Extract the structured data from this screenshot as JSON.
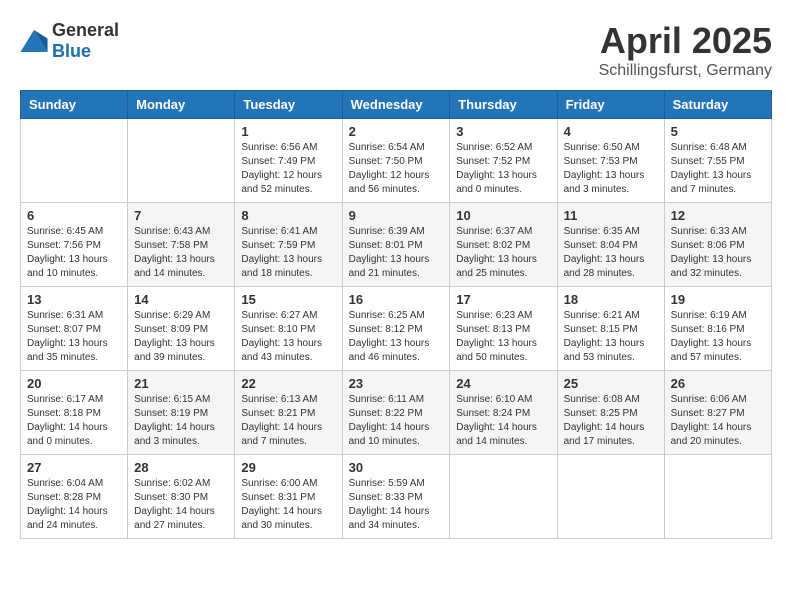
{
  "header": {
    "logo_general": "General",
    "logo_blue": "Blue",
    "title": "April 2025",
    "location": "Schillingsfurst, Germany"
  },
  "weekdays": [
    "Sunday",
    "Monday",
    "Tuesday",
    "Wednesday",
    "Thursday",
    "Friday",
    "Saturday"
  ],
  "weeks": [
    [
      {
        "day": "",
        "info": ""
      },
      {
        "day": "",
        "info": ""
      },
      {
        "day": "1",
        "info": "Sunrise: 6:56 AM\nSunset: 7:49 PM\nDaylight: 12 hours and 52 minutes."
      },
      {
        "day": "2",
        "info": "Sunrise: 6:54 AM\nSunset: 7:50 PM\nDaylight: 12 hours and 56 minutes."
      },
      {
        "day": "3",
        "info": "Sunrise: 6:52 AM\nSunset: 7:52 PM\nDaylight: 13 hours and 0 minutes."
      },
      {
        "day": "4",
        "info": "Sunrise: 6:50 AM\nSunset: 7:53 PM\nDaylight: 13 hours and 3 minutes."
      },
      {
        "day": "5",
        "info": "Sunrise: 6:48 AM\nSunset: 7:55 PM\nDaylight: 13 hours and 7 minutes."
      }
    ],
    [
      {
        "day": "6",
        "info": "Sunrise: 6:45 AM\nSunset: 7:56 PM\nDaylight: 13 hours and 10 minutes."
      },
      {
        "day": "7",
        "info": "Sunrise: 6:43 AM\nSunset: 7:58 PM\nDaylight: 13 hours and 14 minutes."
      },
      {
        "day": "8",
        "info": "Sunrise: 6:41 AM\nSunset: 7:59 PM\nDaylight: 13 hours and 18 minutes."
      },
      {
        "day": "9",
        "info": "Sunrise: 6:39 AM\nSunset: 8:01 PM\nDaylight: 13 hours and 21 minutes."
      },
      {
        "day": "10",
        "info": "Sunrise: 6:37 AM\nSunset: 8:02 PM\nDaylight: 13 hours and 25 minutes."
      },
      {
        "day": "11",
        "info": "Sunrise: 6:35 AM\nSunset: 8:04 PM\nDaylight: 13 hours and 28 minutes."
      },
      {
        "day": "12",
        "info": "Sunrise: 6:33 AM\nSunset: 8:06 PM\nDaylight: 13 hours and 32 minutes."
      }
    ],
    [
      {
        "day": "13",
        "info": "Sunrise: 6:31 AM\nSunset: 8:07 PM\nDaylight: 13 hours and 35 minutes."
      },
      {
        "day": "14",
        "info": "Sunrise: 6:29 AM\nSunset: 8:09 PM\nDaylight: 13 hours and 39 minutes."
      },
      {
        "day": "15",
        "info": "Sunrise: 6:27 AM\nSunset: 8:10 PM\nDaylight: 13 hours and 43 minutes."
      },
      {
        "day": "16",
        "info": "Sunrise: 6:25 AM\nSunset: 8:12 PM\nDaylight: 13 hours and 46 minutes."
      },
      {
        "day": "17",
        "info": "Sunrise: 6:23 AM\nSunset: 8:13 PM\nDaylight: 13 hours and 50 minutes."
      },
      {
        "day": "18",
        "info": "Sunrise: 6:21 AM\nSunset: 8:15 PM\nDaylight: 13 hours and 53 minutes."
      },
      {
        "day": "19",
        "info": "Sunrise: 6:19 AM\nSunset: 8:16 PM\nDaylight: 13 hours and 57 minutes."
      }
    ],
    [
      {
        "day": "20",
        "info": "Sunrise: 6:17 AM\nSunset: 8:18 PM\nDaylight: 14 hours and 0 minutes."
      },
      {
        "day": "21",
        "info": "Sunrise: 6:15 AM\nSunset: 8:19 PM\nDaylight: 14 hours and 3 minutes."
      },
      {
        "day": "22",
        "info": "Sunrise: 6:13 AM\nSunset: 8:21 PM\nDaylight: 14 hours and 7 minutes."
      },
      {
        "day": "23",
        "info": "Sunrise: 6:11 AM\nSunset: 8:22 PM\nDaylight: 14 hours and 10 minutes."
      },
      {
        "day": "24",
        "info": "Sunrise: 6:10 AM\nSunset: 8:24 PM\nDaylight: 14 hours and 14 minutes."
      },
      {
        "day": "25",
        "info": "Sunrise: 6:08 AM\nSunset: 8:25 PM\nDaylight: 14 hours and 17 minutes."
      },
      {
        "day": "26",
        "info": "Sunrise: 6:06 AM\nSunset: 8:27 PM\nDaylight: 14 hours and 20 minutes."
      }
    ],
    [
      {
        "day": "27",
        "info": "Sunrise: 6:04 AM\nSunset: 8:28 PM\nDaylight: 14 hours and 24 minutes."
      },
      {
        "day": "28",
        "info": "Sunrise: 6:02 AM\nSunset: 8:30 PM\nDaylight: 14 hours and 27 minutes."
      },
      {
        "day": "29",
        "info": "Sunrise: 6:00 AM\nSunset: 8:31 PM\nDaylight: 14 hours and 30 minutes."
      },
      {
        "day": "30",
        "info": "Sunrise: 5:59 AM\nSunset: 8:33 PM\nDaylight: 14 hours and 34 minutes."
      },
      {
        "day": "",
        "info": ""
      },
      {
        "day": "",
        "info": ""
      },
      {
        "day": "",
        "info": ""
      }
    ]
  ]
}
